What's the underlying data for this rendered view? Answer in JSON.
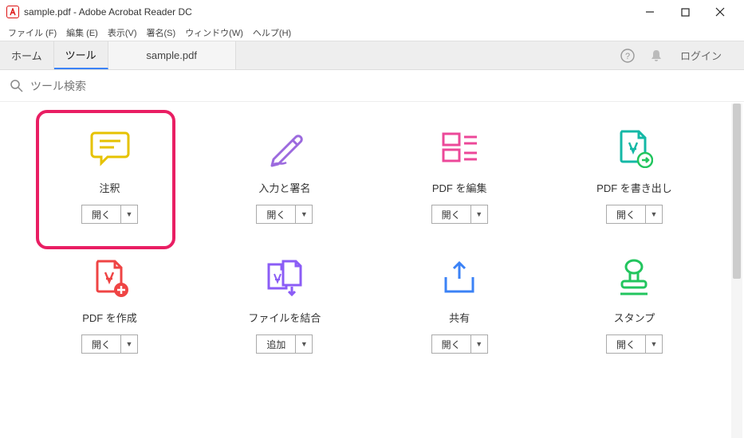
{
  "window": {
    "title": "sample.pdf - Adobe Acrobat Reader DC",
    "app_icon_letter": "A"
  },
  "menu": {
    "items": [
      "ファイル (F)",
      "編集 (E)",
      "表示(V)",
      "署名(S)",
      "ウィンドウ(W)",
      "ヘルプ(H)"
    ]
  },
  "tabbar": {
    "home": "ホーム",
    "tools": "ツール",
    "file_tab": "sample.pdf",
    "login": "ログイン"
  },
  "search": {
    "placeholder": "ツール検索"
  },
  "tools": [
    {
      "label": "注釈",
      "button": "開く"
    },
    {
      "label": "入力と署名",
      "button": "開く"
    },
    {
      "label": "PDF を編集",
      "button": "開く"
    },
    {
      "label": "PDF を書き出し",
      "button": "開く"
    },
    {
      "label": "PDF を作成",
      "button": "開く"
    },
    {
      "label": "ファイルを結合",
      "button": "追加"
    },
    {
      "label": "共有",
      "button": "開く"
    },
    {
      "label": "スタンプ",
      "button": "開く"
    }
  ],
  "highlight": {
    "tool_index": 0
  }
}
